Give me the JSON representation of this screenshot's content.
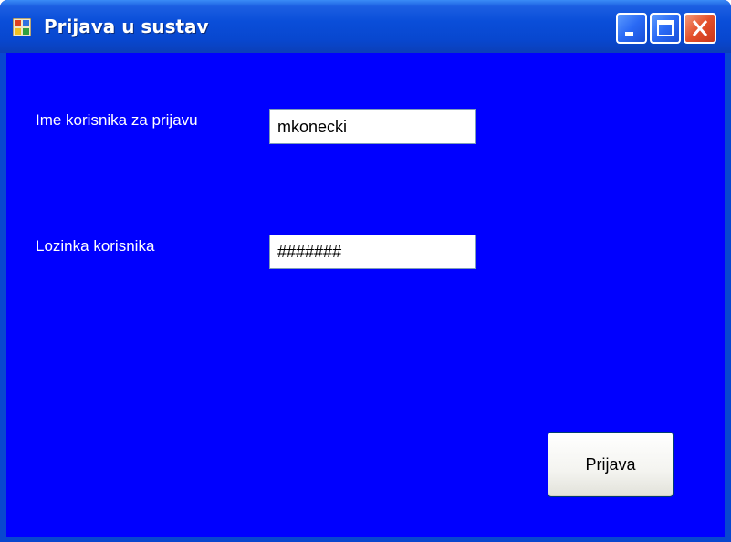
{
  "window": {
    "title": "Prijava u sustav",
    "icon": "app-form-icon",
    "controls": [
      "minimize-icon",
      "maximize-icon",
      "close-icon"
    ]
  },
  "form": {
    "username_label": "Ime korisnika za prijavu",
    "username_value": "mkonecki",
    "password_label": "Lozinka korisnika",
    "password_value": "#######",
    "login_button_label": "Prijava"
  },
  "colors": {
    "form_background": "#0000ff",
    "titlebar": "#0a4ed9",
    "label_text": "#ffffff",
    "close_button": "#e4502a"
  }
}
